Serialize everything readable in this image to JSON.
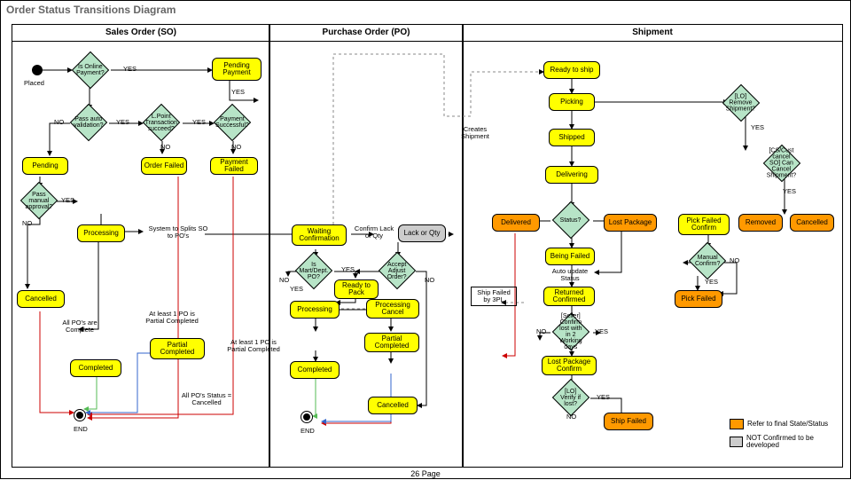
{
  "title": "Order Status Transitions Diagram",
  "swimlanes": {
    "so": "Sales Order (SO)",
    "po": "Purchase Order (PO)",
    "sh": "Shipment"
  },
  "so": {
    "placed": "Placed",
    "online_payment": "Is Online Payment?",
    "pending_payment": "Pending Payment",
    "pass_auto": "Pass auto validation?",
    "l_point": "L.Point Transaction succeed?",
    "payment_success": "Payment Successful?",
    "pending": "Pending",
    "order_failed": "Order Failed",
    "payment_failed": "Payment Failed",
    "pass_manual": "Pass manual approval?",
    "processing": "Processing",
    "system_splits": "System to Splits SO to PO's",
    "cancelled": "Cancelled",
    "all_po_complete": "All PO's are Complete",
    "atleast1": "At least 1 PO is Partial Completed",
    "partial_completed": "Partial Completed",
    "completed": "Completed",
    "all_po_cancel": "All PO's Status = Cancelled",
    "end": "END"
  },
  "po": {
    "waiting_conf": "Waiting Confirmation",
    "confirm_lack": "Confirm Lack of Qty",
    "lack_qty": "Lack or Qty",
    "mart_dept": "Is Mart/Dept. PO?",
    "accept_adjust": "Accept Adjust Order?",
    "ready_pack": "Ready to Pack",
    "processing": "Processing",
    "processing_cancel": "Processing Cancel",
    "partial_completed": "Partial Completed",
    "completed": "Completed",
    "atleast1": "At least 1 PO is Partial Completed",
    "cancelled": "Cancelled",
    "creates_shipment": "Creates Shipment",
    "end": "END"
  },
  "sh": {
    "ready_ship": "Ready to ship",
    "picking": "Picking",
    "lo_remove": "[LO] Remove Shipment?",
    "shipped": "Shipped",
    "cs_cancel": "[CS/Cust cancel SO] Can Cancel Shipment?",
    "delivering": "Delivering",
    "status": "Status?",
    "delivered": "Delivered",
    "being_failed": "Being Failed",
    "lost_package": "Lost Package",
    "pick_failed_confirm": "Pick Failed Confirm",
    "removed": "Removed",
    "cancelled": "Cancelled",
    "auto_update": "Auto update Status",
    "manual_confirm": "Manual Confirm?",
    "ship_failed_3pl": "Ship Failed by 3PL",
    "returned_confirmed": "Returned Confirmed",
    "pick_failed": "Pick Failed",
    "seller_confirm": "[Seller] Confirm lost with in 2 Working days",
    "lost_confirm": "Lost Package Confirm",
    "lo_verify": "[LO] Verify if lost?",
    "ship_failed": "Ship Failed"
  },
  "labels": {
    "yes": "YES",
    "no": "NO"
  },
  "legend": {
    "orange": "Refer to final State/Status",
    "grey": "NOT Confirmed to be developed"
  },
  "footer": "26 Page"
}
